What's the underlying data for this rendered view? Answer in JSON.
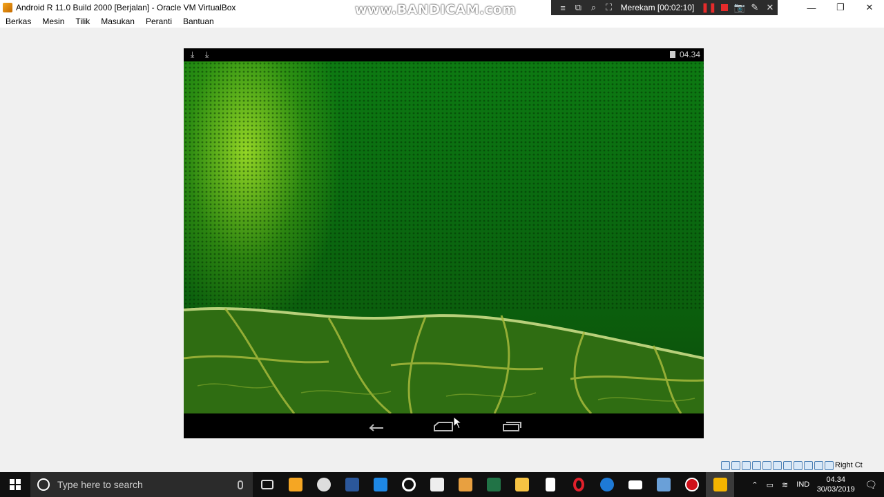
{
  "window": {
    "title": "Android R 11.0 Build 2000 [Berjalan] - Oracle VM VirtualBox",
    "watermark": "www.BANDICAM.com",
    "recorder_status": "Merekam [00:02:10]"
  },
  "menu": {
    "items": [
      "Berkas",
      "Mesin",
      "Tilik",
      "Masukan",
      "Peranti",
      "Bantuan"
    ]
  },
  "android": {
    "status_time": "04.34",
    "accent": "#0b6e12"
  },
  "vm_status": {
    "host_key": "Right Ct"
  },
  "taskbar": {
    "search_placeholder": "Type here to search",
    "language": "IND",
    "clock_time": "04.34",
    "clock_date": "30/03/2019"
  }
}
